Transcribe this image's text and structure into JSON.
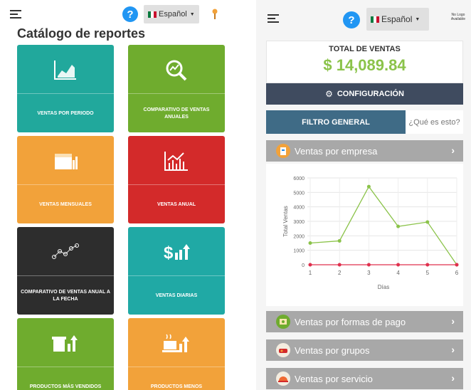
{
  "left": {
    "lang": "Español",
    "help": "?",
    "title": "Catálogo de reportes",
    "tiles": [
      {
        "label": "VENTAS POR PERIODO",
        "color": "#21a89c",
        "icon": "area-chart-icon"
      },
      {
        "label": "COMPARATIVO DE VENTAS ANUALES",
        "color": "#6fac2e",
        "icon": "magnifier-chart-icon"
      },
      {
        "label": "VENTAS MENSUALES",
        "color": "#f2a23a",
        "icon": "calendar-chart-icon"
      },
      {
        "label": "VENTAS ANUAL",
        "color": "#d32a2a",
        "icon": "line-bars-chart-icon"
      },
      {
        "label": "COMPARATIVO DE VENTAS ANUAL A LA FECHA",
        "color": "#2d2d2d",
        "icon": "scatter-line-icon"
      },
      {
        "label": "VENTAS DIARIAS",
        "color": "#20a9a5",
        "icon": "dollar-chart-icon"
      },
      {
        "label": "PRODUCTOS MÁS VENDIDOS",
        "color": "#6fac2e",
        "icon": "cup-chart-icon"
      },
      {
        "label": "PRODUCTOS MENOS",
        "color": "#f2a23a",
        "icon": "coffee-chart-icon"
      }
    ]
  },
  "right": {
    "lang": "Español",
    "help": "?",
    "logo": "No Logo Available",
    "total_title": "TOTAL DE VENTAS",
    "total_value": "$ 14,089.84",
    "config": "CONFIGURACIÓN",
    "tab_active": "FILTRO GENERAL",
    "tab_other": "¿Qué es esto?",
    "sections": [
      {
        "label": "Ventas por empresa",
        "icon": "company-icon",
        "color": "#f2a23a"
      },
      {
        "label": "Ventas por formas de pago",
        "icon": "payment-icon",
        "color": "#6fac2e"
      },
      {
        "label": "Ventas por grupos",
        "icon": "groups-icon",
        "color": "#d32a2a"
      },
      {
        "label": "Ventas por servicio",
        "icon": "service-icon",
        "color": "#f06a32"
      }
    ]
  },
  "colors": {
    "green": "#8bc34a",
    "dark_bar": "#3f4b5f",
    "tab_blue": "#3f6b86",
    "accordion": "#a8a8a8",
    "help_blue": "#2196f3"
  },
  "chart_data": {
    "type": "line",
    "x": [
      1,
      2,
      3,
      4,
      5,
      6
    ],
    "xlabel": "Días",
    "ylabel": "Total Ventas",
    "ylim": [
      0,
      6000
    ],
    "yticks": [
      0,
      1000,
      2000,
      3000,
      4000,
      5000,
      6000
    ],
    "series": [
      {
        "color": "#8bc34a",
        "values": [
          1500,
          1650,
          5400,
          2650,
          2950,
          0
        ]
      },
      {
        "color": "#e0304e",
        "values": [
          0,
          0,
          0,
          0,
          0,
          0
        ]
      }
    ],
    "grid": true
  }
}
